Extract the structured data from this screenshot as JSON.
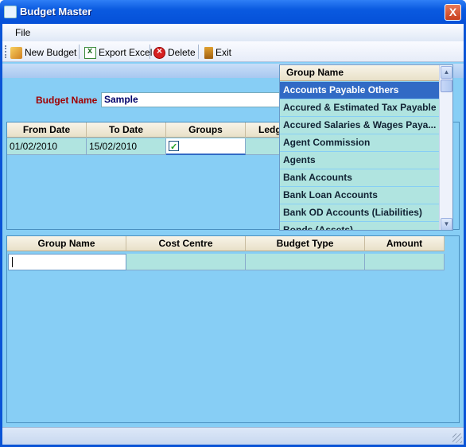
{
  "window": {
    "title": "Budget Master",
    "close_label": "X"
  },
  "menu": {
    "file": "File"
  },
  "toolbar": {
    "new_budget": "New Budget",
    "export_excel": "Export Excel",
    "delete": "Delete",
    "exit": "Exit"
  },
  "form": {
    "budget_name_label": "Budget Name",
    "budget_name_value": "Sample"
  },
  "grid1": {
    "headers": [
      "From Date",
      "To Date",
      "Groups",
      "Ledg"
    ],
    "row": {
      "from_date": "01/02/2010",
      "to_date": "15/02/2010",
      "groups_checked": true
    }
  },
  "dropdown": {
    "header": "Group Name",
    "items": [
      "Accounts Payable Others",
      "Accured & Estimated Tax Payable",
      "Accured Salaries & Wages Paya...",
      "Agent Commission",
      "Agents",
      "Bank Accounts",
      "Bank Loan Accounts",
      "Bank OD Accounts (Liabilities)",
      "Bonds (Assets)"
    ],
    "selected_index": 0
  },
  "grid2": {
    "headers": [
      "Group Name",
      "Cost Centre",
      "Budget Type",
      "Amount"
    ]
  },
  "colors": {
    "client_bg": "#87cef5",
    "row_bg": "#b0e4e0",
    "selected": "#316ac5",
    "label_red": "#a00000"
  }
}
